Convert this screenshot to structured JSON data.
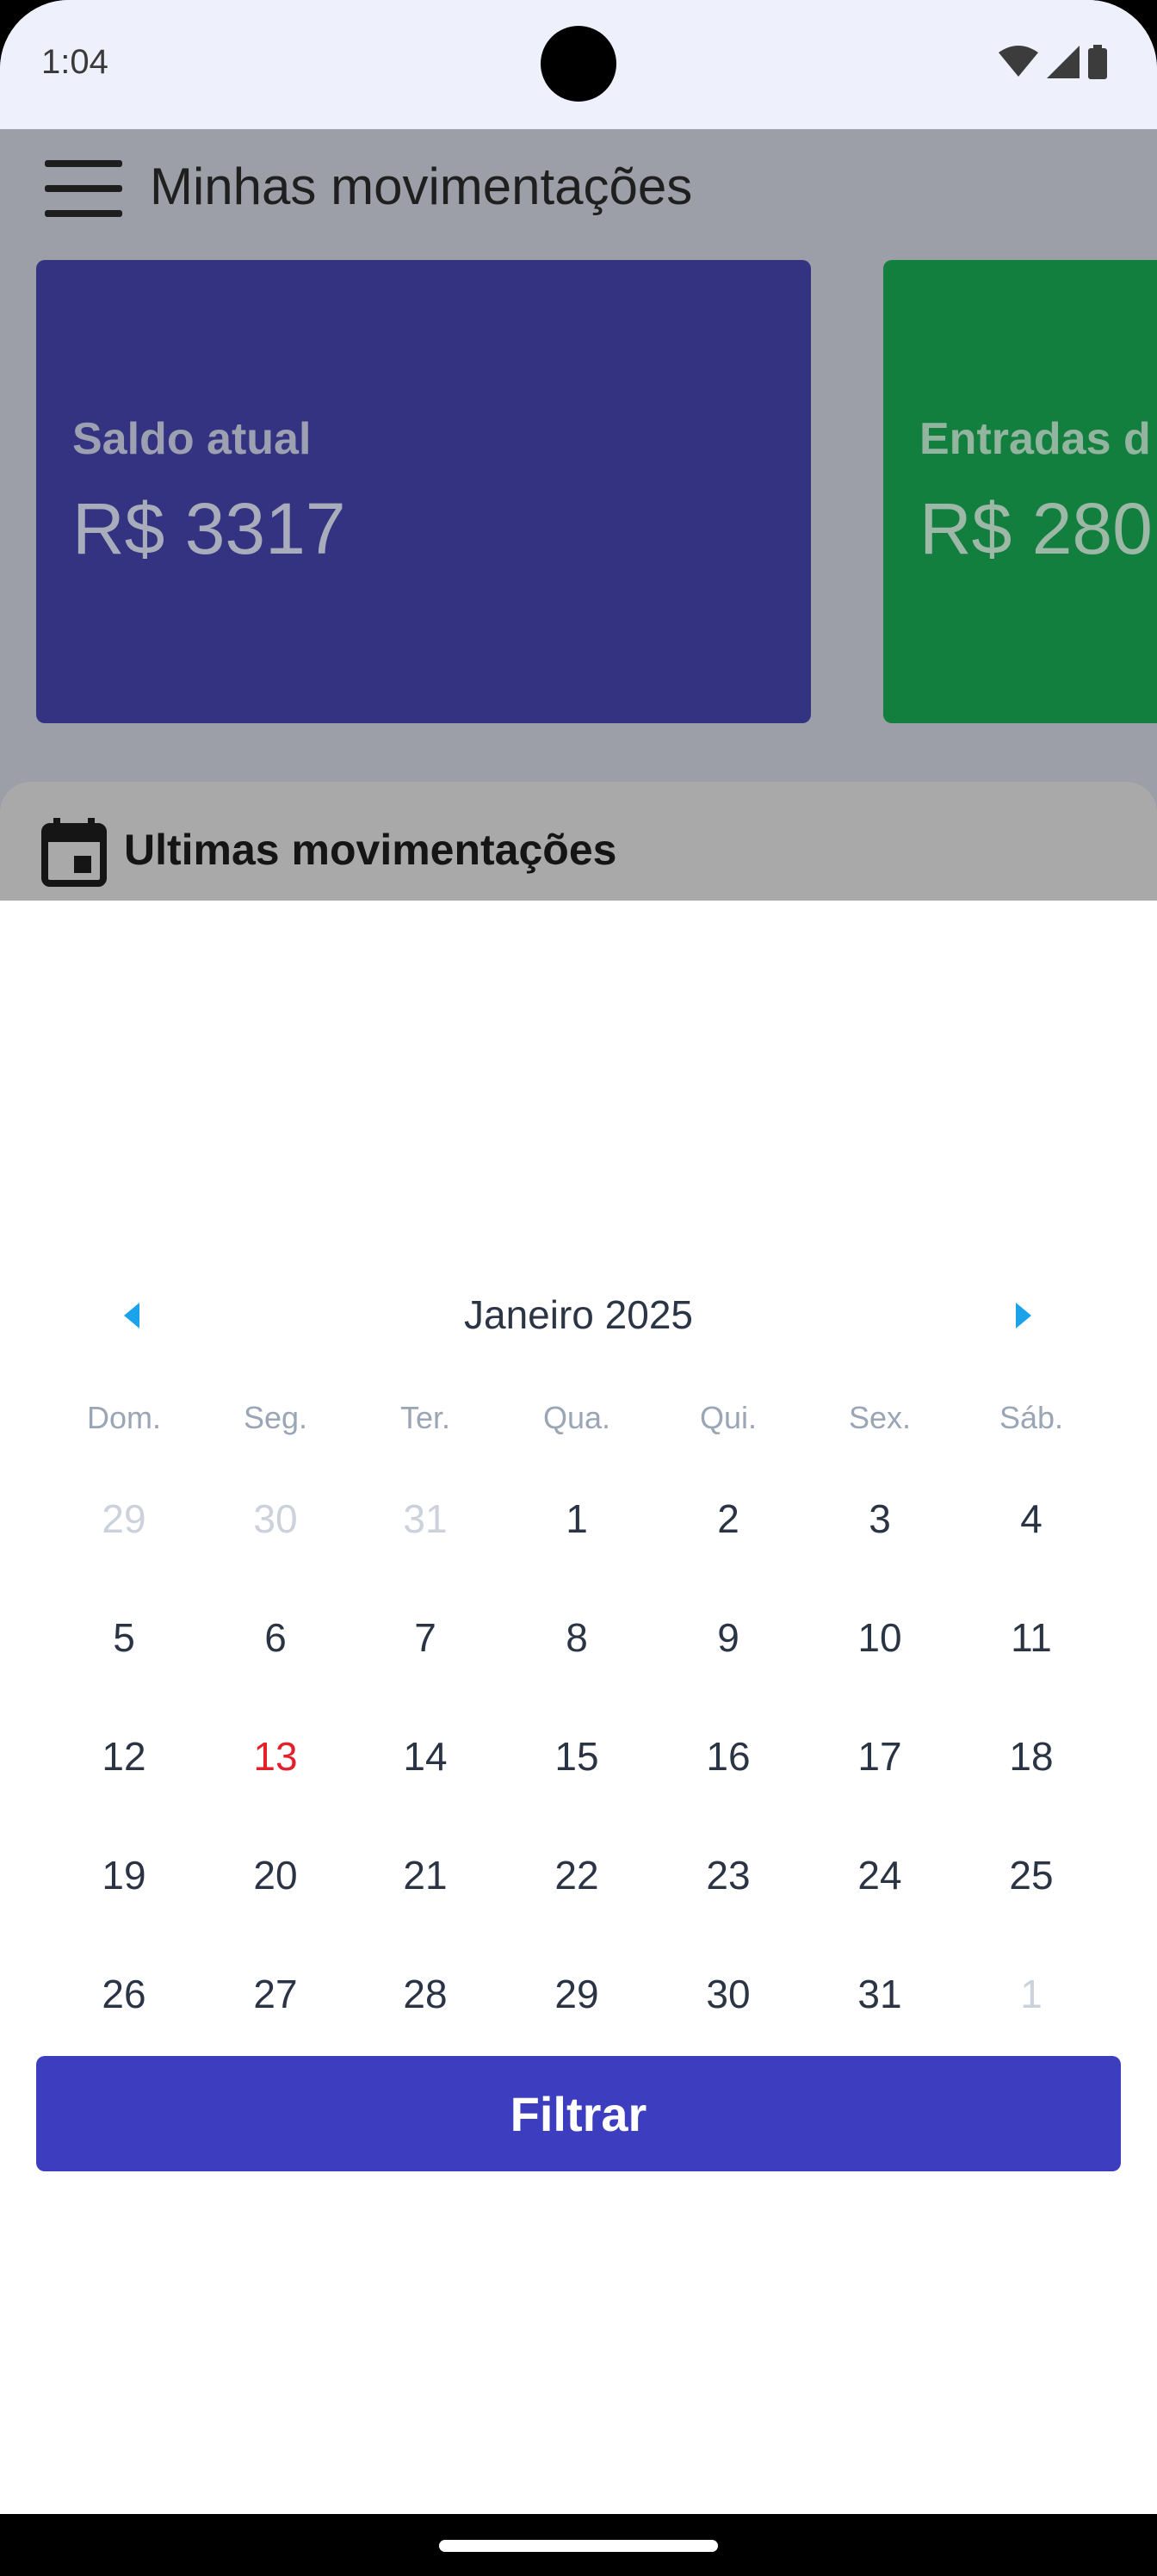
{
  "status_bar": {
    "time": "1:04"
  },
  "app_bar": {
    "title": "Minhas movimentações"
  },
  "cards": [
    {
      "label": "Saldo atual",
      "value": "R$ 3317"
    },
    {
      "label": "Entradas d",
      "value": "R$ 280"
    }
  ],
  "recent": {
    "title": "Ultimas movimentações"
  },
  "calendar": {
    "month_title": "Janeiro 2025",
    "weekdays": [
      "Dom.",
      "Seg.",
      "Ter.",
      "Qua.",
      "Qui.",
      "Sex.",
      "Sáb."
    ],
    "weeks": [
      [
        {
          "d": "29",
          "muted": true
        },
        {
          "d": "30",
          "muted": true
        },
        {
          "d": "31",
          "muted": true
        },
        {
          "d": "1"
        },
        {
          "d": "2"
        },
        {
          "d": "3"
        },
        {
          "d": "4"
        }
      ],
      [
        {
          "d": "5"
        },
        {
          "d": "6"
        },
        {
          "d": "7"
        },
        {
          "d": "8"
        },
        {
          "d": "9"
        },
        {
          "d": "10"
        },
        {
          "d": "11"
        }
      ],
      [
        {
          "d": "12"
        },
        {
          "d": "13",
          "today": true
        },
        {
          "d": "14"
        },
        {
          "d": "15"
        },
        {
          "d": "16"
        },
        {
          "d": "17"
        },
        {
          "d": "18"
        }
      ],
      [
        {
          "d": "19"
        },
        {
          "d": "20"
        },
        {
          "d": "21"
        },
        {
          "d": "22"
        },
        {
          "d": "23"
        },
        {
          "d": "24"
        },
        {
          "d": "25"
        }
      ],
      [
        {
          "d": "26"
        },
        {
          "d": "27"
        },
        {
          "d": "28"
        },
        {
          "d": "29"
        },
        {
          "d": "30"
        },
        {
          "d": "31"
        },
        {
          "d": "1",
          "muted": true
        }
      ]
    ]
  },
  "filter_button": {
    "label": "Filtrar"
  },
  "colors": {
    "accent": "#3d3dbf",
    "today": "#e4202a",
    "nav_arrow": "#1aa3e8",
    "saldo_card": "#333381",
    "entradas_card": "#137f3f"
  },
  "icons": {
    "menu": "hamburger-menu-icon",
    "calendar": "calendar-icon",
    "prev": "triangle-left-icon",
    "next": "triangle-right-icon",
    "wifi": "wifi-icon",
    "signal": "cellular-signal-icon",
    "battery": "battery-icon"
  }
}
